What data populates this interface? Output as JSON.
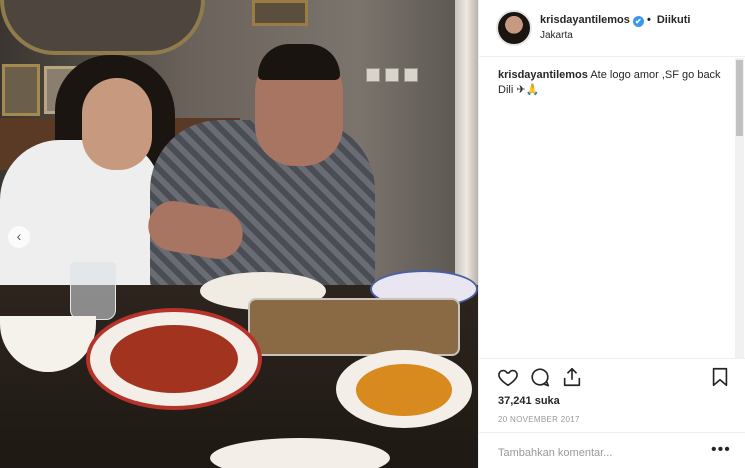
{
  "post": {
    "username": "krisdayantilemos",
    "verified_mark": "✔",
    "follow_separator": "•",
    "follow_status": "Diikuti",
    "location": "Jakarta",
    "caption_user": "krisdayantilemos",
    "caption_text": "Ate logo amor ,SF go back Dili ✈🙏",
    "likes": "37,241 suka",
    "date": "20 NOVEMBER 2017"
  },
  "photo": {
    "carousel_prev": "‹"
  },
  "comment": {
    "placeholder": "Tambahkan komentar...",
    "more_label": "•••"
  },
  "icons": [
    "heart-icon",
    "comment-icon",
    "share-icon",
    "bookmark-icon"
  ],
  "colors": {
    "verified": "#3897f0",
    "text": "#262626",
    "muted": "#999999"
  }
}
